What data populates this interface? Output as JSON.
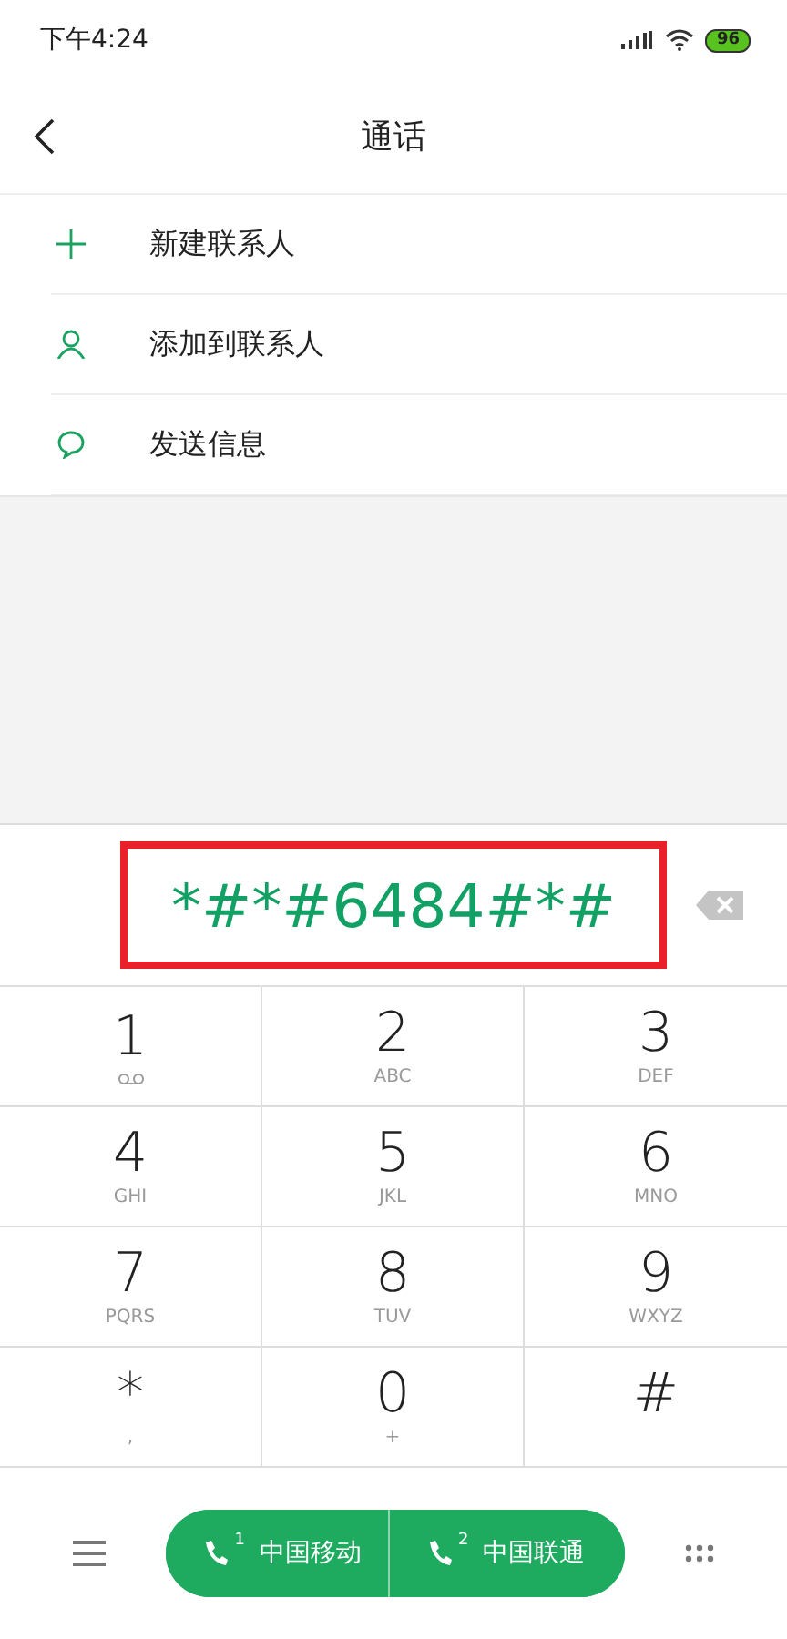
{
  "status_bar": {
    "time": "下午4:24",
    "battery": "96"
  },
  "header": {
    "title": "通话"
  },
  "actions": [
    {
      "kind": "add",
      "label": "新建联系人"
    },
    {
      "kind": "person",
      "label": "添加到联系人"
    },
    {
      "kind": "message",
      "label": "发送信息"
    }
  ],
  "display": {
    "number": "*#*#6484#*#",
    "highlighted": true
  },
  "keys": [
    {
      "digit": "1",
      "kind": "voicemail"
    },
    {
      "digit": "2",
      "letters": "ABC",
      "kind": "text"
    },
    {
      "digit": "3",
      "letters": "DEF",
      "kind": "text"
    },
    {
      "digit": "4",
      "letters": "GHI",
      "kind": "text"
    },
    {
      "digit": "5",
      "letters": "JKL",
      "kind": "text"
    },
    {
      "digit": "6",
      "letters": "MNO",
      "kind": "text"
    },
    {
      "digit": "7",
      "letters": "PQRS",
      "kind": "text"
    },
    {
      "digit": "8",
      "letters": "TUV",
      "kind": "text"
    },
    {
      "digit": "9",
      "letters": "WXYZ",
      "kind": "text"
    },
    {
      "digit": "*",
      "letters": ",",
      "kind": "text"
    },
    {
      "digit": "0",
      "letters": "+",
      "kind": "text"
    },
    {
      "digit": "#",
      "kind": "text"
    }
  ],
  "call_buttons": [
    {
      "sim": "1",
      "label": "中国移动"
    },
    {
      "sim": "2",
      "label": "中国联通"
    }
  ]
}
